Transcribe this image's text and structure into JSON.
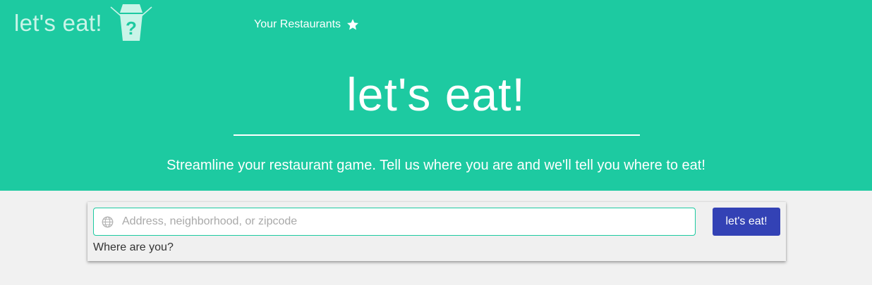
{
  "header": {
    "brand": "let's eat!",
    "logo_icon": "takeout-box-question-icon",
    "nav": {
      "your_restaurants_label": "Your Restaurants",
      "icon": "star-icon"
    }
  },
  "hero": {
    "title": "let's eat!",
    "tagline": "Streamline your restaurant game. Tell us where you are and we'll tell you where to eat!"
  },
  "search": {
    "icon": "globe-icon",
    "placeholder": "Address, neighborhood, or zipcode",
    "value": "",
    "label": "Where are you?",
    "button_label": "let's eat!"
  },
  "colors": {
    "primary": "#1dcaa1",
    "button": "#3342b5",
    "background": "#f1f1f1",
    "brand_text": "#c9f4e8"
  }
}
